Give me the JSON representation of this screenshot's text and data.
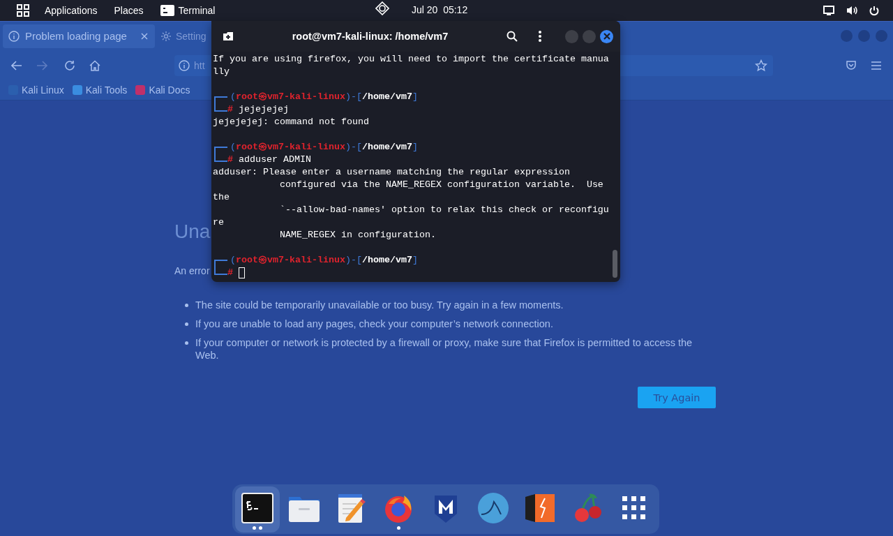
{
  "top_bar": {
    "menus": [
      {
        "label": "Applications",
        "kind": "text"
      },
      {
        "label": "Places",
        "kind": "text"
      },
      {
        "label": "Terminal",
        "kind": "app"
      }
    ],
    "clock": "Jul 20  05:12"
  },
  "browser": {
    "tabs": [
      {
        "label": "Problem loading page",
        "selected": true,
        "kind": "info"
      },
      {
        "label": "Setting",
        "selected": false,
        "kind": "settings"
      }
    ],
    "address": "htt",
    "bookmarks": [
      {
        "label": "Kali Linux",
        "color": "#2b5fae"
      },
      {
        "label": "Kali Tools",
        "color": "#3a8de0"
      },
      {
        "label": "Kali Docs",
        "color": "#c0306a"
      }
    ],
    "error_page": {
      "heading": "Una",
      "intro": "An error",
      "bullets": [
        "The site could be temporarily unavailable or too busy. Try again in a few moments.",
        "If you are unable to load any pages, check your computer’s network connection.",
        "If your computer or network is protected by a firewall or proxy, make sure that Firefox is permitted to access the Web."
      ],
      "button": "Try Again"
    }
  },
  "terminal": {
    "title": "root@vm7-kali-linux: /home/vm7",
    "lines": [
      {
        "kind": "output",
        "text": "If you are using firefox, you will need to import the certificate manua"
      },
      {
        "kind": "output",
        "text": "lly"
      },
      {
        "kind": "blank"
      },
      {
        "kind": "prompt",
        "segments": [
          {
            "kind": "frame",
            "text": "("
          },
          {
            "kind": "user",
            "text": "root㉿vm7-kali-linux"
          },
          {
            "kind": "frame",
            "text": ")-["
          },
          {
            "kind": "path",
            "text": "/home/vm7"
          },
          {
            "kind": "frame",
            "text": "]"
          }
        ],
        "symbol": "#",
        "command": "jejejejej"
      },
      {
        "kind": "output",
        "text": "jejejejej: command not found"
      },
      {
        "kind": "blank"
      },
      {
        "kind": "prompt",
        "segments": [
          {
            "kind": "frame",
            "text": "("
          },
          {
            "kind": "user",
            "text": "root㉿vm7-kali-linux"
          },
          {
            "kind": "frame",
            "text": ")-["
          },
          {
            "kind": "path",
            "text": "/home/vm7"
          },
          {
            "kind": "frame",
            "text": "]"
          }
        ],
        "symbol": "#",
        "command": "adduser ADMIN"
      },
      {
        "kind": "output",
        "text": "adduser: Please enter a username matching the regular expression"
      },
      {
        "kind": "output",
        "text": "            configured via the NAME_REGEX configuration variable.  Use"
      },
      {
        "kind": "output",
        "text": "the"
      },
      {
        "kind": "output",
        "text": "            `--allow-bad-names' option to relax this check or reconfigu"
      },
      {
        "kind": "output",
        "text": "re"
      },
      {
        "kind": "output",
        "text": "            NAME_REGEX in configuration."
      },
      {
        "kind": "blank"
      },
      {
        "kind": "prompt",
        "segments": [
          {
            "kind": "frame",
            "text": "("
          },
          {
            "kind": "user",
            "text": "root㉿vm7-kali-linux"
          },
          {
            "kind": "frame",
            "text": ")-["
          },
          {
            "kind": "path",
            "text": "/home/vm7"
          },
          {
            "kind": "frame",
            "text": "]"
          }
        ],
        "symbol": "#",
        "cursor": true
      }
    ]
  },
  "dock": {
    "items": [
      {
        "kind": "terminal",
        "selected": true,
        "running": true,
        "multiple_windows": true
      },
      {
        "kind": "files",
        "selected": false,
        "running": false
      },
      {
        "kind": "editor",
        "selected": false,
        "running": false
      },
      {
        "kind": "browser",
        "selected": false,
        "running": true,
        "multiple_windows": false
      },
      {
        "kind": "shield",
        "selected": false,
        "running": false
      },
      {
        "kind": "shark",
        "selected": false,
        "running": false
      },
      {
        "kind": "burp",
        "selected": false,
        "running": false
      },
      {
        "kind": "cherry",
        "selected": false,
        "running": false
      },
      {
        "kind": "grid",
        "selected": false,
        "running": false
      }
    ]
  }
}
